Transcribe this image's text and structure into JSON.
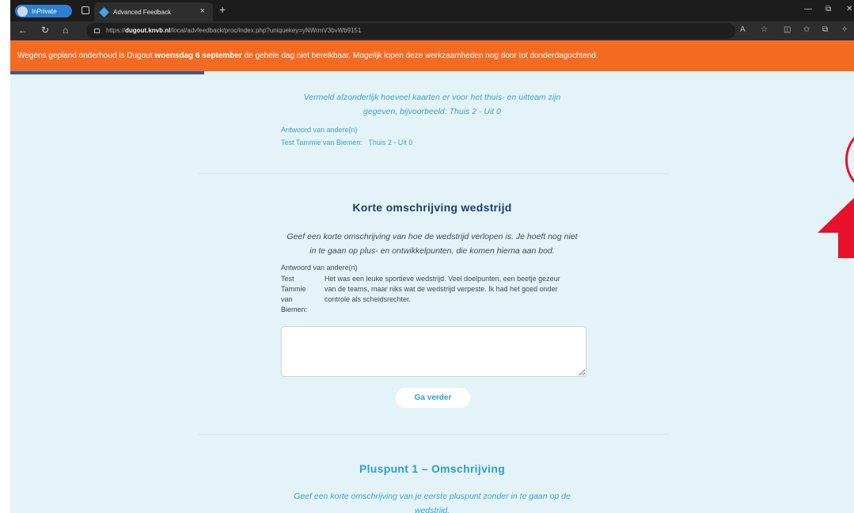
{
  "browser": {
    "inprivate_label": "InPrivate",
    "tab_title": "Advanced Feedback",
    "url_prefix": "https://",
    "url_domain": "dugout.knvb.nl",
    "url_path": "/local/advfeedback/proc/index.php?uniquekey=yNWrmV3bvWb9151"
  },
  "notice": {
    "text_before": "Wegens gepland onderhoud is Dugout ",
    "text_bold": "woensdag 6 september",
    "text_after": " de gehele dag niet bereikbaar. Mogelijk lopen deze werkzaamheden nog door tot donderdagochtend."
  },
  "section_cards": {
    "desc_line1": "Vermeld afzonderlijk hoeveel kaarten er voor het thuis- en uitteam zijn",
    "desc_line2": "gegeven, bijvoorbeeld: Thuis 2 - Uit 0",
    "answers_label": "Antwoord van andere(n)",
    "answer_name": "Test Tammie van Biemen:",
    "answer_value": "Thuis 2 - Uit 0"
  },
  "section_description": {
    "heading": "Korte omschrijving wedstrijd",
    "desc_line1": "Geef een korte omschrijving van hoe de wedstrijd verlopen is. Je hoeft nog niet",
    "desc_line2": "in te gaan op plus- en ontwikkelpunten, die komen hierna aan bod.",
    "answers_label": "Antwoord van andere(n)",
    "answer_name_1": "Test",
    "answer_name_2": "Tammie",
    "answer_name_3": "van",
    "answer_name_4": "Biemen:",
    "answer_text_1": "Het was een leuke sportieve wedstrijd. Veel doelpunten, een beetje gezeur",
    "answer_text_2": "van de teams, maar niks wat de wedstrijd verpeste. Ik had het goed onder",
    "answer_text_3": "controle als scheidsrechter.",
    "textarea_value": "",
    "button_label": "Ga verder"
  },
  "section_pluspunt": {
    "heading": "Pluspunt 1 – Omschrijving",
    "desc_line1": "Geef een korte omschrijving van je eerste pluspunt zonder in te gaan op de",
    "desc_line2": "wedstrijd."
  },
  "progress": {
    "fraction": 0.23
  },
  "colors": {
    "notice_bg": "#f36b22",
    "page_bg": "#e4f3f8",
    "heading_dark": "#273a66",
    "accent_blue": "#2f9fcf",
    "annotation_red": "#e8102b"
  }
}
